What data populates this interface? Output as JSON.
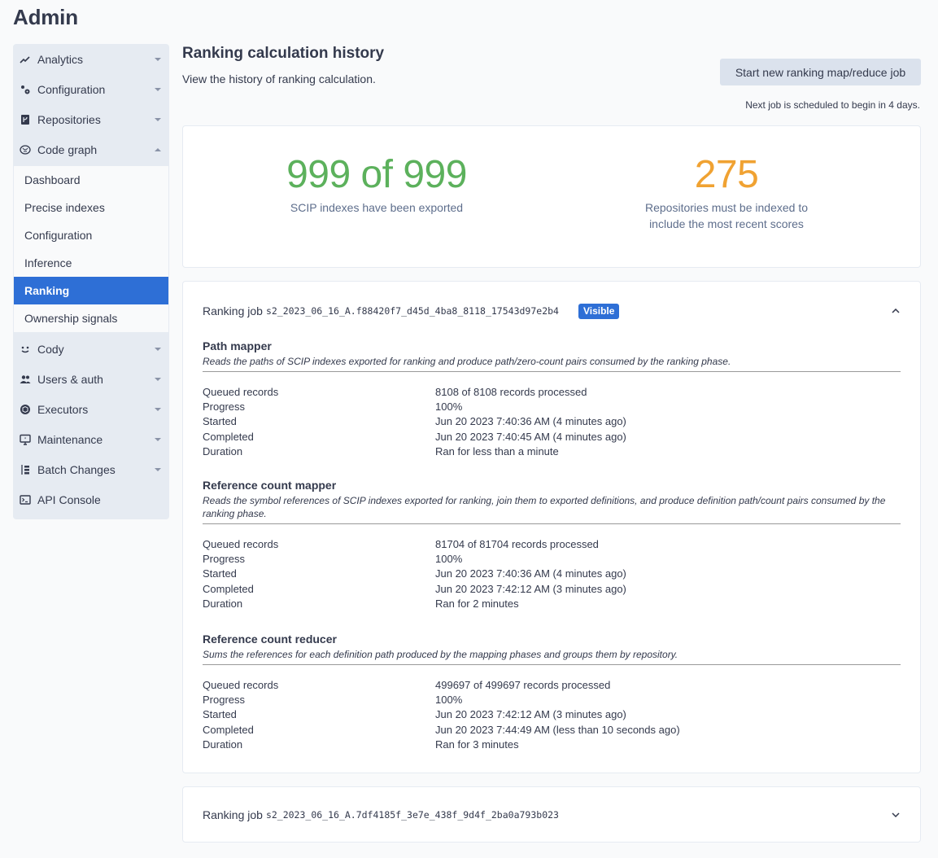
{
  "app": {
    "title": "Admin"
  },
  "sidebar": {
    "groups": [
      {
        "label": "Analytics",
        "icon": "chart-line-icon",
        "expanded": false
      },
      {
        "label": "Configuration",
        "icon": "cog-icon",
        "expanded": false
      },
      {
        "label": "Repositories",
        "icon": "source-repository-icon",
        "expanded": false
      },
      {
        "label": "Code graph",
        "icon": "brain-icon",
        "expanded": true,
        "items": [
          {
            "label": "Dashboard",
            "active": false
          },
          {
            "label": "Precise indexes",
            "active": false
          },
          {
            "label": "Configuration",
            "active": false
          },
          {
            "label": "Inference",
            "active": false
          },
          {
            "label": "Ranking",
            "active": true
          },
          {
            "label": "Ownership signals",
            "active": false
          }
        ]
      },
      {
        "label": "Cody",
        "icon": "cody-icon",
        "expanded": false
      },
      {
        "label": "Users & auth",
        "icon": "account-multiple-icon",
        "expanded": false
      },
      {
        "label": "Executors",
        "icon": "cube-icon",
        "expanded": false
      },
      {
        "label": "Maintenance",
        "icon": "monitor-star-icon",
        "expanded": false
      },
      {
        "label": "Batch Changes",
        "icon": "batch-changes-icon",
        "expanded": false
      },
      {
        "label": "API Console",
        "icon": "console-icon"
      }
    ]
  },
  "header": {
    "title": "Ranking calculation history",
    "subtitle": "View the history of ranking calculation.",
    "start_button": "Start new ranking map/reduce job",
    "next_job": "Next job is scheduled to begin in 4 days."
  },
  "summary": {
    "exported": {
      "value": "999 of 999",
      "label": "SCIP indexes have been exported",
      "color": "#5cb15c"
    },
    "repos": {
      "value": "275",
      "label_line1": "Repositories must be indexed to",
      "label_line2": "include the most recent scores",
      "color": "#f0a232"
    }
  },
  "jobs": [
    {
      "label": "Ranking job",
      "id": "s2_2023_06_16_A.f88420f7_d45d_4ba8_8118_17543d97e2b4",
      "badge": "Visible",
      "expanded": true,
      "phases": [
        {
          "title": "Path mapper",
          "description": "Reads the paths of SCIP indexes exported for ranking and produce path/zero-count pairs consumed by the ranking phase.",
          "rows": [
            {
              "key": "Queued records",
              "value": "8108 of 8108 records processed"
            },
            {
              "key": "Progress",
              "value": "100%"
            },
            {
              "key": "Started",
              "value": "Jun 20 2023 7:40:36 AM (4 minutes ago)"
            },
            {
              "key": "Completed",
              "value": "Jun 20 2023 7:40:45 AM (4 minutes ago)"
            },
            {
              "key": "Duration",
              "value": "Ran for less than a minute"
            }
          ]
        },
        {
          "title": "Reference count mapper",
          "description": "Reads the symbol references of SCIP indexes exported for ranking, join them to exported definitions, and produce definition path/count pairs consumed by the ranking phase.",
          "rows": [
            {
              "key": "Queued records",
              "value": "81704 of 81704 records processed"
            },
            {
              "key": "Progress",
              "value": "100%"
            },
            {
              "key": "Started",
              "value": "Jun 20 2023 7:40:36 AM (4 minutes ago)"
            },
            {
              "key": "Completed",
              "value": "Jun 20 2023 7:42:12 AM (3 minutes ago)"
            },
            {
              "key": "Duration",
              "value": "Ran for 2 minutes"
            }
          ]
        },
        {
          "title": "Reference count reducer",
          "description": "Sums the references for each definition path produced by the mapping phases and groups them by repository.",
          "rows": [
            {
              "key": "Queued records",
              "value": "499697 of 499697 records processed"
            },
            {
              "key": "Progress",
              "value": "100%"
            },
            {
              "key": "Started",
              "value": "Jun 20 2023 7:42:12 AM (3 minutes ago)"
            },
            {
              "key": "Completed",
              "value": "Jun 20 2023 7:44:49 AM (less than 10 seconds ago)"
            },
            {
              "key": "Duration",
              "value": "Ran for 3 minutes"
            }
          ]
        }
      ]
    },
    {
      "label": "Ranking job",
      "id": "s2_2023_06_16_A.7df4185f_3e7e_438f_9d4f_2ba0a793b023",
      "expanded": false
    }
  ]
}
